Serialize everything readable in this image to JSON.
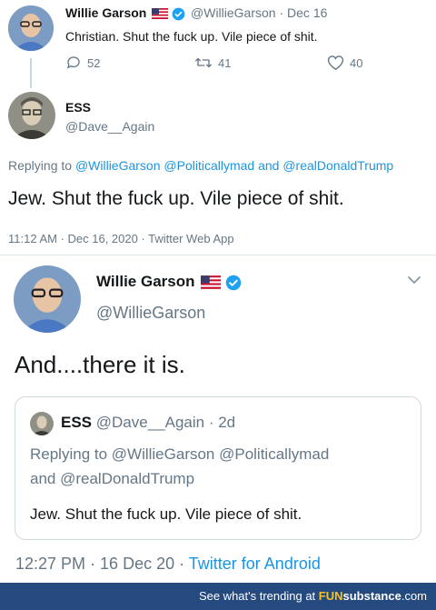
{
  "tweet1": {
    "name": "Willie Garson",
    "handle": "@WillieGarson",
    "date": "· Dec 16",
    "text": "Christian. Shut the fuck up. Vile piece of shit.",
    "replies": "52",
    "retweets": "41",
    "likes": "40"
  },
  "reply": {
    "name": "ESS",
    "handle": "@Dave__Again",
    "replying_prefix": "Replying to",
    "replying_mentions": "@WillieGarson @Politicallymad and @realDonaldTrump",
    "text": "Jew. Shut the fuck up. Vile piece of shit.",
    "timestamp": "11:12 AM · Dec 16, 2020 · Twitter Web App"
  },
  "tweet2": {
    "name": "Willie Garson",
    "handle": "@WillieGarson",
    "text": "And....there it is.",
    "time_date": "12:27 PM · 16 Dec 20 ·",
    "source": "Twitter for Android"
  },
  "quote": {
    "name": "ESS",
    "handle_date": "@Dave__Again · 2d",
    "replying_line1": "Replying to @WillieGarson @Politicallymad",
    "replying_line2": "and @realDonaldTrump",
    "text": "Jew. Shut the fuck up. Vile piece of shit."
  },
  "footer": {
    "text": "See what's trending at",
    "brand_fun": "FUN",
    "brand_sub": "substance",
    "brand_com": ".com"
  },
  "colors": {
    "link_blue": "#1b95e0",
    "muted_gray": "#657786",
    "footer_bg": "#244a80",
    "brand_yellow": "#f7c21a"
  }
}
